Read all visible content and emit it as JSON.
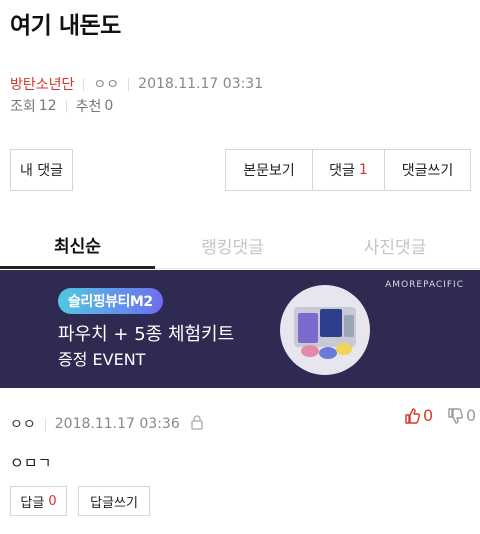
{
  "post": {
    "title": "여기 내돈도",
    "author": "방탄소년단",
    "nickname": "ㅇㅇ",
    "datetime": "2018.11.17 03:31",
    "views_label": "조회",
    "views": "12",
    "recommend_label": "추천",
    "recommend": "0"
  },
  "buttons": {
    "my_comments": "내 댓글",
    "view_body": "본문보기",
    "comments_label": "댓글",
    "comments_count": "1",
    "write_comment": "댓글쓰기"
  },
  "tabs": [
    {
      "label": "최신순",
      "active": true
    },
    {
      "label": "랭킹댓글",
      "active": false
    },
    {
      "label": "사진댓글",
      "active": false
    }
  ],
  "banner": {
    "pill": "슬리핑뷰티M2",
    "line1": "파우치 + 5종 체험키트",
    "line2": "증정 EVENT",
    "brand": "AMOREPACIFIC"
  },
  "comment": {
    "nickname": "ㅇㅇ",
    "datetime": "2018.11.17 03:36",
    "likes": "0",
    "dislikes": "0",
    "body": "ㅇㅁㄱ",
    "reply_label": "답글",
    "reply_count": "0",
    "write_reply": "답글쓰기"
  },
  "colors": {
    "accent": "#d9352d",
    "banner_bg": "#2e2a52"
  }
}
